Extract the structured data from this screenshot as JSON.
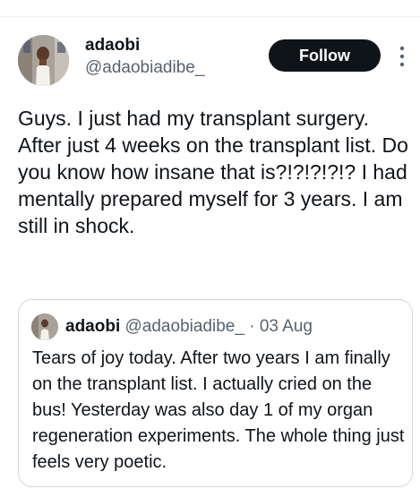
{
  "tweet": {
    "author": {
      "display_name": "adaobi",
      "handle": "@adaobiadibe_"
    },
    "follow_label": "Follow",
    "text": "Guys. I just had my transplant surgery. After just 4 weeks on the transplant list. Do you know how insane that is?!?!?!?!? I had mentally prepared myself for 3 years. I am still in shock."
  },
  "quoted_tweet": {
    "display_name": "adaobi",
    "handle": "@adaobiadibe_",
    "separator": "·",
    "date": "03 Aug",
    "text": "Tears of joy today. After two years I am finally on the transplant list. I actually cried on the bus! Yesterday was also day 1 of my organ regeneration experiments. The whole thing just feels very poetic."
  },
  "icons": {
    "more": "more-vertical-icon",
    "avatar": "avatar"
  },
  "colors": {
    "text_primary": "#0f1419",
    "text_secondary": "#536471",
    "follow_bg": "#0f1419",
    "border": "#cfd9de"
  }
}
